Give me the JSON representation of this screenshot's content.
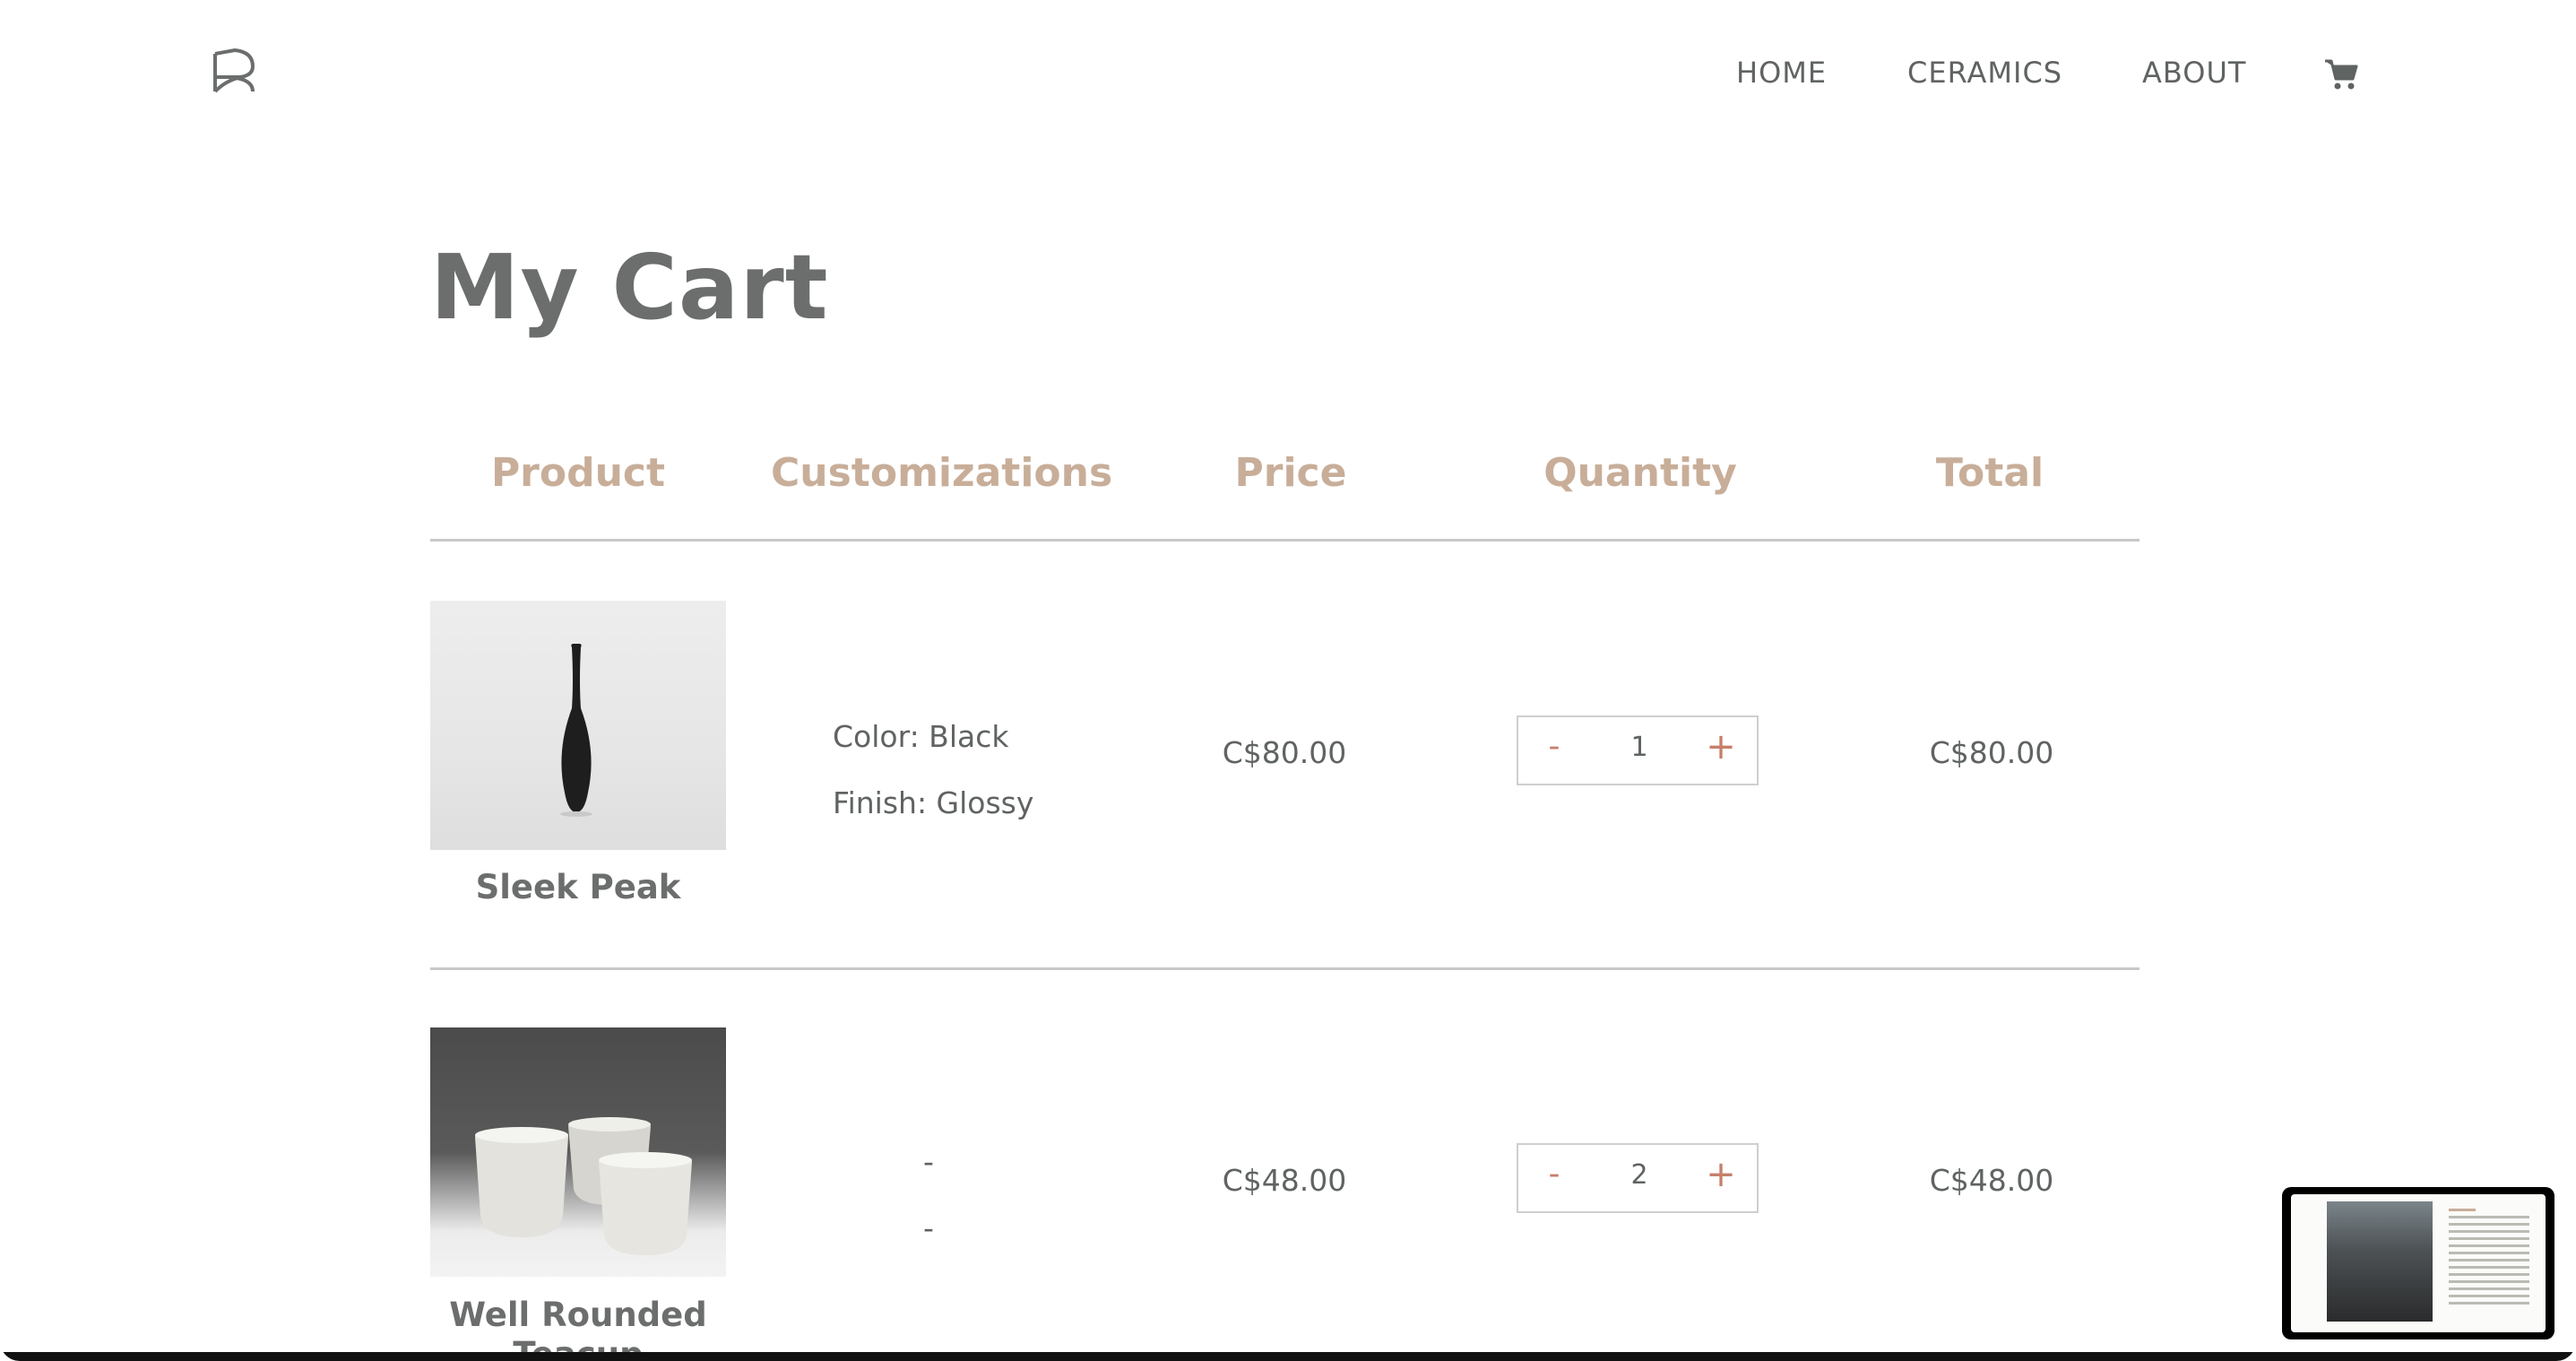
{
  "nav": {
    "home": "HOME",
    "ceramics": "CERAMICS",
    "about": "ABOUT",
    "cart_icon": "shopping-cart-icon"
  },
  "page": {
    "title": "My Cart"
  },
  "table": {
    "headers": [
      "Product",
      "Customizations",
      "Price",
      "Quantity",
      "Total"
    ],
    "rows": [
      {
        "product": "Sleek Peak",
        "customizations": [
          "Color: Black",
          "Finish: Glossy"
        ],
        "price": "C$80.00",
        "quantity": "1",
        "total": "C$80.00"
      },
      {
        "product": "Well Rounded Teacup",
        "customizations": [
          "-",
          "-"
        ],
        "price": "C$48.00",
        "quantity": "2",
        "total": "C$48.00"
      }
    ]
  },
  "controls": {
    "decrement": "-",
    "increment": "+"
  },
  "colors": {
    "accent_heading": "#c8ae99",
    "accent_button": "#c77f6a",
    "text": "#6b6e6c"
  }
}
